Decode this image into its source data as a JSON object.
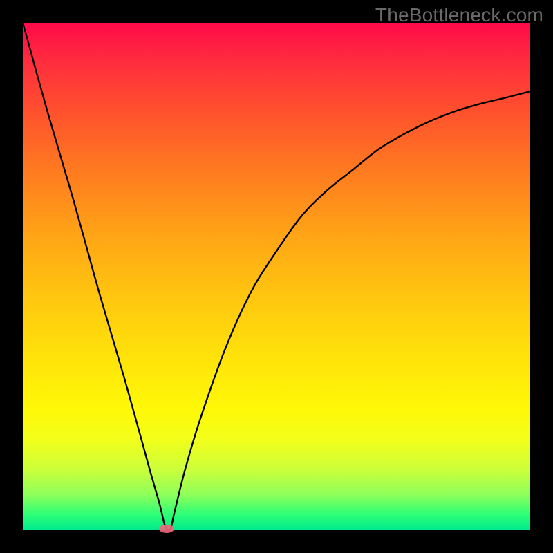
{
  "watermark": "TheBottleneck.com",
  "colors": {
    "frame": "#000000",
    "curve": "#000000",
    "marker": "#f0677a"
  },
  "chart_data": {
    "type": "line",
    "title": "",
    "xlabel": "",
    "ylabel": "",
    "xlim": [
      0,
      100
    ],
    "ylim": [
      0,
      100
    ],
    "grid": false,
    "legend": false,
    "series": [
      {
        "name": "bottleneck-curve",
        "x": [
          0,
          5,
          10,
          15,
          20,
          25,
          27,
          28,
          29,
          30,
          32,
          35,
          40,
          45,
          50,
          55,
          60,
          65,
          70,
          75,
          80,
          85,
          90,
          95,
          100
        ],
        "values": [
          100,
          82,
          65,
          47,
          30,
          12,
          5,
          1,
          0,
          4,
          12,
          22,
          36,
          47,
          55,
          62,
          67,
          71,
          75,
          78,
          80.5,
          82.5,
          84,
          85.2,
          86.5
        ]
      }
    ],
    "annotations": [
      {
        "name": "bottleneck-point",
        "x": 28.3,
        "y": 0.3
      }
    ]
  }
}
